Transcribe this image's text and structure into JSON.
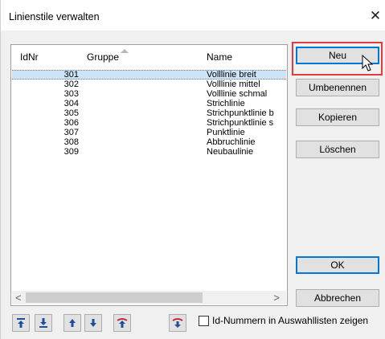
{
  "window": {
    "title": "Linienstile verwalten",
    "close_glyph": "✕"
  },
  "list": {
    "headers": {
      "id": "IdNr",
      "group": "Gruppe",
      "name": "Name"
    },
    "rows": [
      {
        "id": "301",
        "group": "",
        "name": "Volllinie breit",
        "selected": true
      },
      {
        "id": "302",
        "group": "",
        "name": "Volllinie mittel"
      },
      {
        "id": "303",
        "group": "",
        "name": "Volllinie schmal"
      },
      {
        "id": "304",
        "group": "",
        "name": "Strichlinie"
      },
      {
        "id": "305",
        "group": "",
        "name": "Strichpunktlinie b"
      },
      {
        "id": "306",
        "group": "",
        "name": "Strichpunktlinie s"
      },
      {
        "id": "307",
        "group": "",
        "name": "Punktlinie"
      },
      {
        "id": "308",
        "group": "",
        "name": "Abbruchlinie"
      },
      {
        "id": "309",
        "group": "",
        "name": "Neubaulinie"
      }
    ],
    "scroll_left": "<",
    "scroll_right": ">"
  },
  "buttons": {
    "new": "Neu",
    "rename": "Umbenennen",
    "copy": "Kopieren",
    "delete": "Löschen",
    "ok": "OK",
    "cancel": "Abbrechen"
  },
  "toolbar": {
    "icons": [
      "move-to-top-icon",
      "move-to-bottom-icon",
      "move-up-icon",
      "move-down-icon",
      "insert-above-icon",
      "insert-below-icon"
    ]
  },
  "option": {
    "label": "Id-Nummern in Auswahllisten zeigen",
    "checked": false
  },
  "colors": {
    "selection": "#cce4f7",
    "highlight": "#e03c3c",
    "icon_blue": "#1f4e9c",
    "icon_red": "#c8202a",
    "focus": "#0078d7"
  }
}
